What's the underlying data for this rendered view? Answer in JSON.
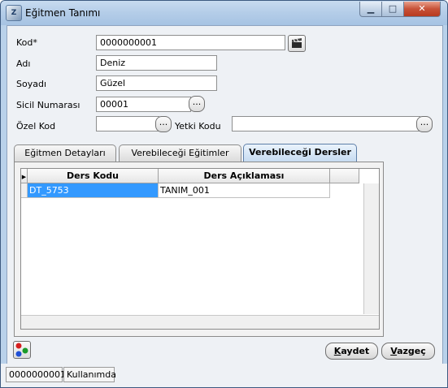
{
  "window": {
    "title": "Eğitmen Tanımı",
    "icon_text": "Z",
    "min_symbol": "▁",
    "max_symbol": "□",
    "close_symbol": "✕"
  },
  "form": {
    "kod_label": "Kod*",
    "kod_value": "0000000001",
    "adi_label": "Adı",
    "adi_value": "Deniz",
    "soyadi_label": "Soyadı",
    "soyadi_value": "Güzel",
    "sicil_label": "Sicil Numarası",
    "sicil_value": "00001",
    "ozel_kod_label": "Özel Kod",
    "ozel_kod_value": "",
    "yetki_kodu_label": "Yetki Kodu",
    "yetki_kodu_value": "",
    "ellipsis": "..."
  },
  "tabs": [
    {
      "label": "Eğitmen Detayları",
      "active": false
    },
    {
      "label": "Verebileceği Eğitimler",
      "active": false
    },
    {
      "label": "Verebileceği Dersler",
      "active": true
    }
  ],
  "grid": {
    "columns": [
      "Ders Kodu",
      "Ders Açıklaması"
    ],
    "rows": [
      [
        "DT_5753",
        "TANIM_001"
      ]
    ],
    "row_indicator": "▶"
  },
  "buttons": {
    "save_hot": "K",
    "save_rest": "aydet",
    "cancel_hot": "V",
    "cancel_rest": "azgeç"
  },
  "status": {
    "code": "0000000001",
    "state": "Kullanımda"
  },
  "colors": {
    "selection": "#3399ff",
    "titlebar": "#b9d1ea",
    "close": "#c75238"
  }
}
